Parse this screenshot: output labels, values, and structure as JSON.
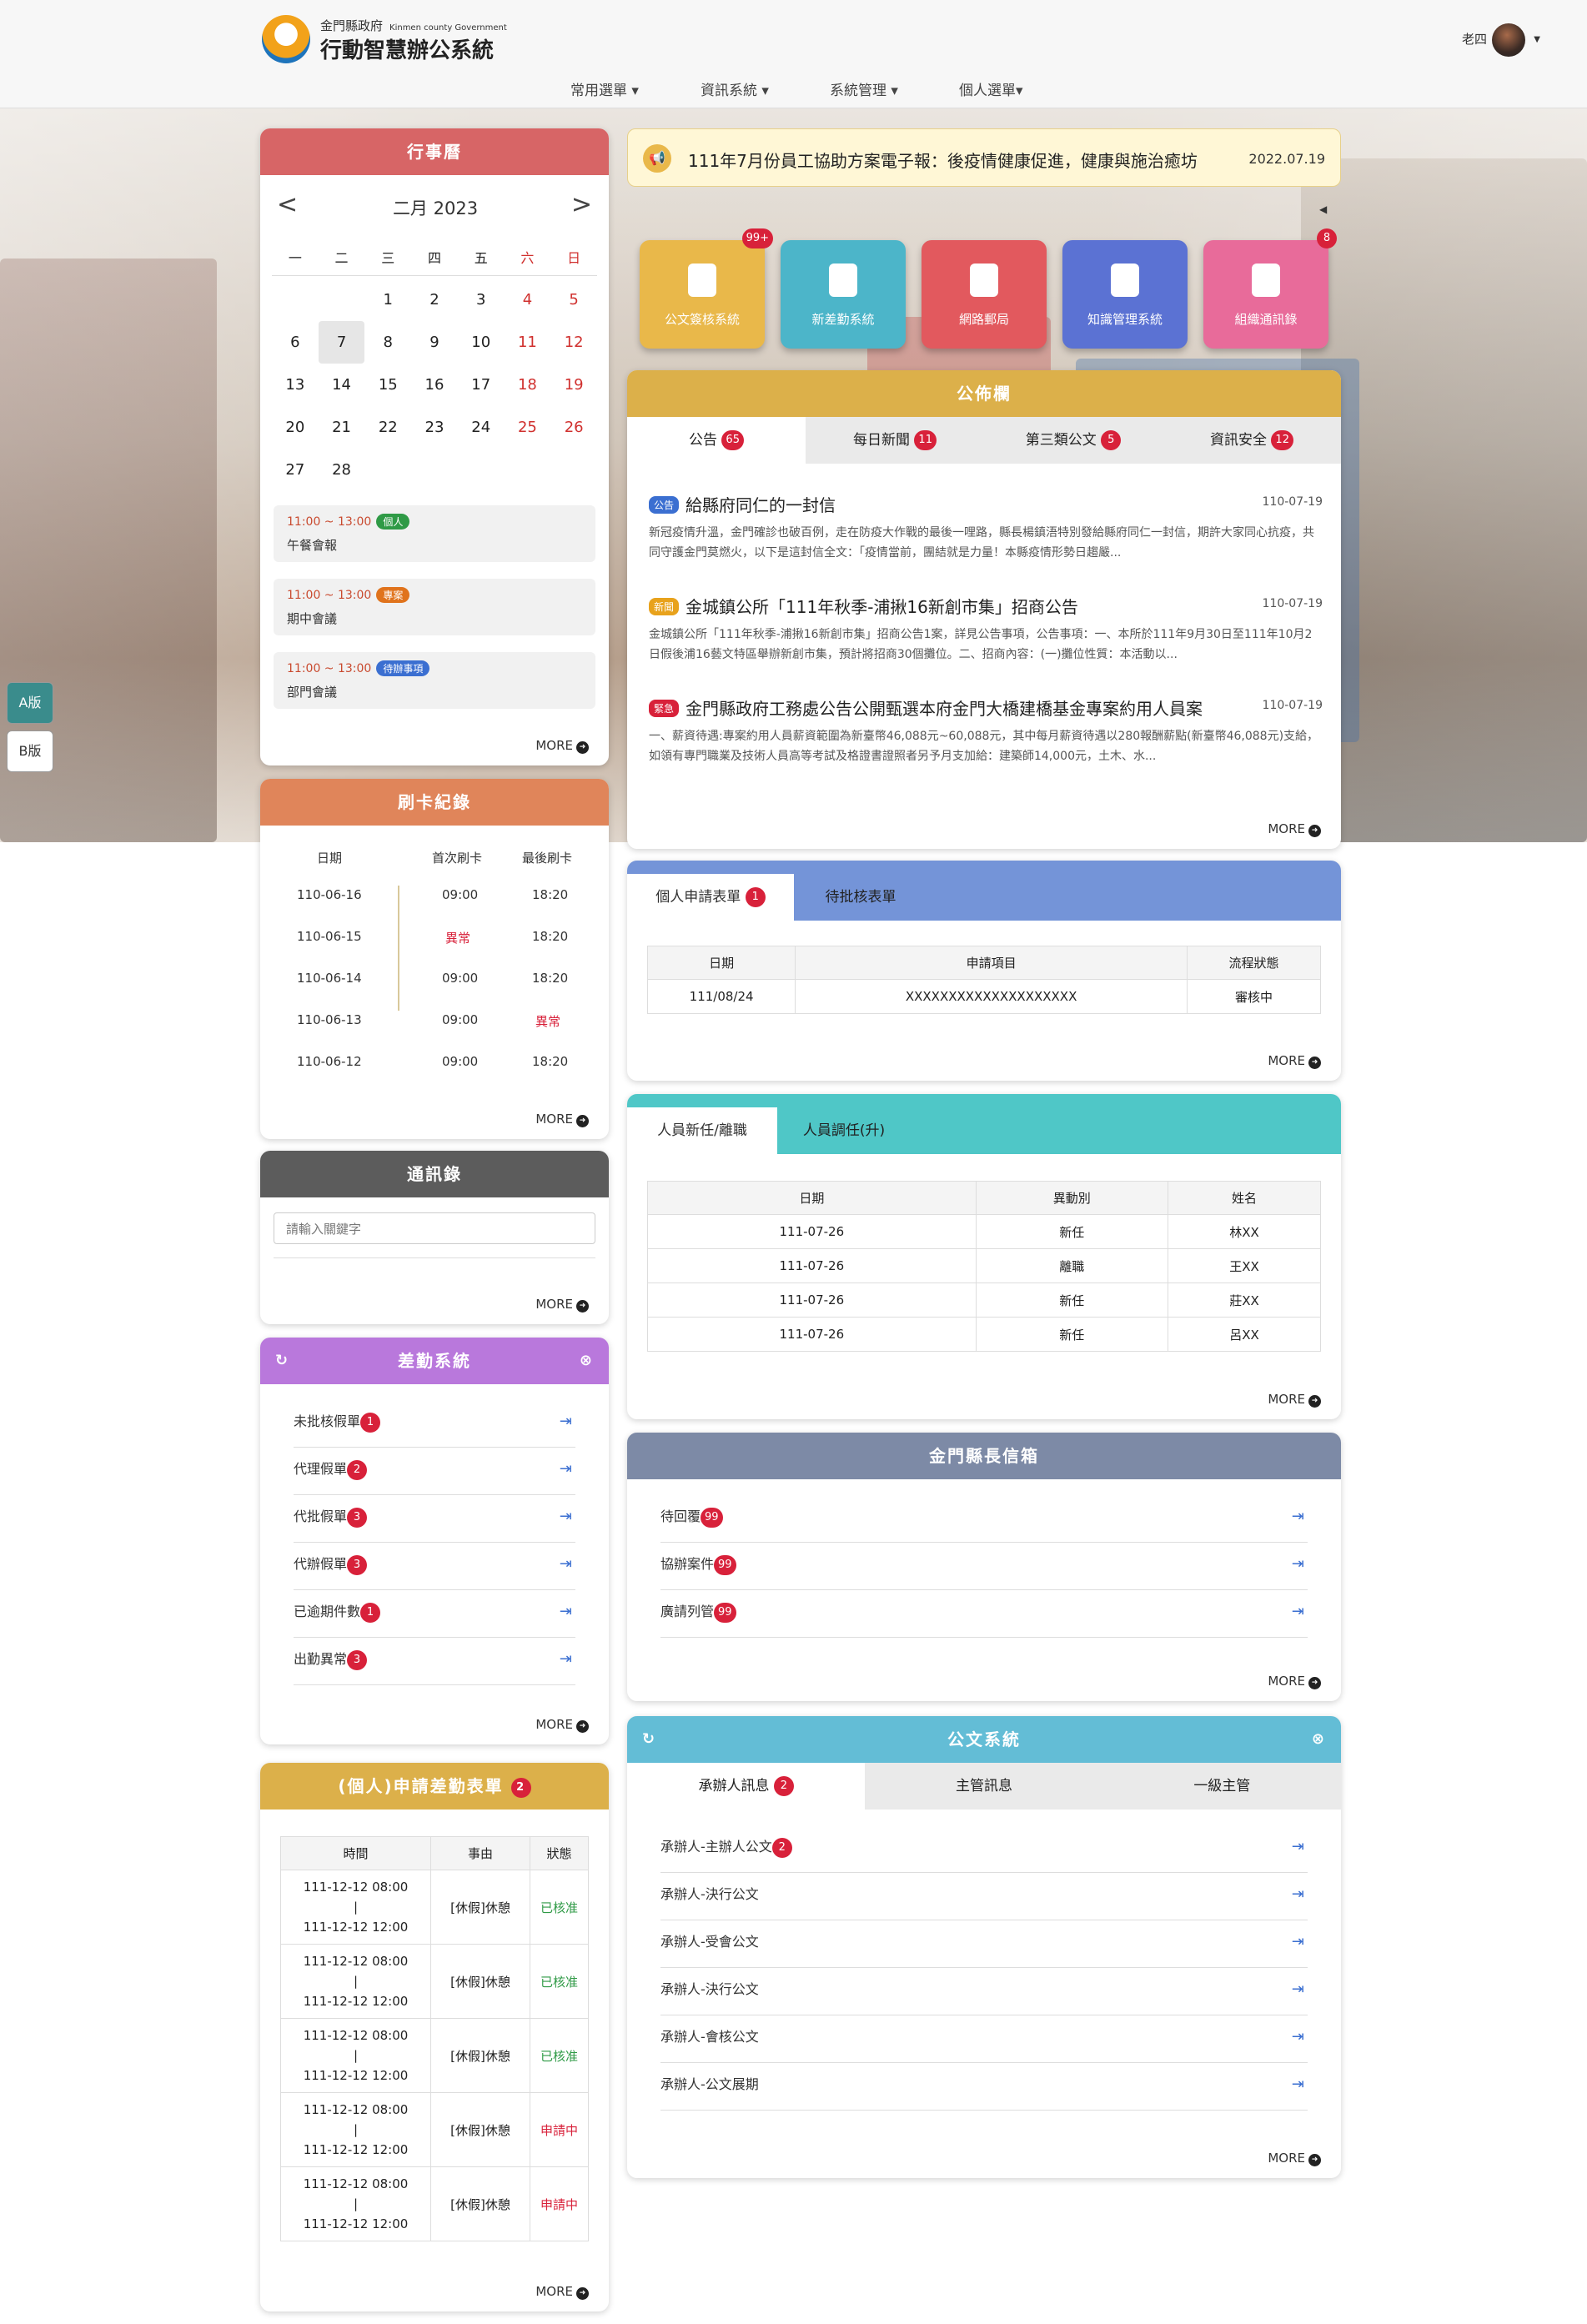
{
  "header": {
    "org": "金門縣政府",
    "org_en": "Kinmen county Government",
    "system": "行動智慧辦公系統",
    "user": "老四",
    "menu": [
      "常用選單 ▾",
      "資訊系統 ▾",
      "系統管理 ▾",
      "個人選單▾"
    ]
  },
  "side": {
    "a": "A版",
    "b": "B版"
  },
  "calendar": {
    "title": "行事曆",
    "month": "二月 2023",
    "prev": "<",
    "next": ">",
    "weekdays": [
      "一",
      "二",
      "三",
      "四",
      "五",
      "六",
      "日"
    ],
    "rows": [
      [
        "",
        "",
        "1",
        "2",
        "3",
        "4",
        "5"
      ],
      [
        "6",
        "7",
        "8",
        "9",
        "10",
        "11",
        "12"
      ],
      [
        "13",
        "14",
        "15",
        "16",
        "17",
        "18",
        "19"
      ],
      [
        "20",
        "21",
        "22",
        "23",
        "24",
        "25",
        "26"
      ],
      [
        "27",
        "28",
        "",
        "",
        "",
        "",
        ""
      ]
    ],
    "events": [
      {
        "time": "11:00 ~ 13:00",
        "tag": "個人",
        "name": "午餐會報"
      },
      {
        "time": "11:00 ~ 13:00",
        "tag": "專案",
        "name": "期中會議"
      },
      {
        "time": "11:00 ~ 13:00",
        "tag": "待辦事項",
        "name": "部門會議"
      }
    ],
    "more": "MORE"
  },
  "card_log": {
    "title": "刷卡紀錄",
    "headers": [
      "日期",
      "首次刷卡",
      "最後刷卡"
    ],
    "rows": [
      [
        "110-06-16",
        "09:00",
        "18:20"
      ],
      [
        "110-06-15",
        "異常",
        "18:20"
      ],
      [
        "110-06-14",
        "09:00",
        "18:20"
      ],
      [
        "110-06-13",
        "09:00",
        "異常"
      ],
      [
        "110-06-12",
        "09:00",
        "18:20"
      ]
    ],
    "more": "MORE"
  },
  "contacts": {
    "title": "通訊錄",
    "placeholder": "請輸入關鍵字",
    "more": "MORE"
  },
  "attendance": {
    "title": "差勤系統",
    "items": [
      {
        "label": "未批核假單",
        "n": "1"
      },
      {
        "label": "代理假單",
        "n": "2"
      },
      {
        "label": "代批假單",
        "n": "3"
      },
      {
        "label": "代辦假單",
        "n": "3"
      },
      {
        "label": "已逾期件數",
        "n": "1"
      },
      {
        "label": "出勤異常",
        "n": "3"
      }
    ],
    "more": "MORE"
  },
  "leave": {
    "title": "(個人)申請差勤表單",
    "n": "2",
    "headers": [
      "時間",
      "事由",
      "狀態"
    ],
    "rows": [
      {
        "s": "111-12-12 08:00",
        "sep": "|",
        "e": "111-12-12 12:00",
        "r": "[休假]休憩",
        "st": "已核准"
      },
      {
        "s": "111-12-12 08:00",
        "sep": "|",
        "e": "111-12-12 12:00",
        "r": "[休假]休憩",
        "st": "已核准"
      },
      {
        "s": "111-12-12 08:00",
        "sep": "|",
        "e": "111-12-12 12:00",
        "r": "[休假]休憩",
        "st": "已核准"
      },
      {
        "s": "111-12-12 08:00",
        "sep": "|",
        "e": "111-12-12 12:00",
        "r": "[休假]休憩",
        "st": "申請中"
      },
      {
        "s": "111-12-12 08:00",
        "sep": "|",
        "e": "111-12-12 12:00",
        "r": "[休假]休憩",
        "st": "申請中"
      }
    ],
    "more": "MORE"
  },
  "news": {
    "text": "111年7月份員工協助方案電子報：後疫情健康促進，健康與施治癒坊",
    "date": "2022.07.19"
  },
  "apps": [
    {
      "label": "公文簽核系統",
      "badge": "99+",
      "color": "#e9b84a"
    },
    {
      "label": "新差勤系統",
      "badge": "",
      "color": "#4cb5c9"
    },
    {
      "label": "網路郵局",
      "badge": "",
      "color": "#e2595e"
    },
    {
      "label": "知識管理系統",
      "badge": "",
      "color": "#5b72d3"
    },
    {
      "label": "組織通訊錄",
      "badge": "8",
      "color": "#e86b9a"
    }
  ],
  "bulletin": {
    "title": "公佈欄",
    "tabs": [
      {
        "label": "公告",
        "n": "65"
      },
      {
        "label": "每日新聞",
        "n": "11"
      },
      {
        "label": "第三類公文",
        "n": "5"
      },
      {
        "label": "資訊安全",
        "n": "12"
      }
    ],
    "items": [
      {
        "lb": "公告",
        "lbc": "#3b6fd1",
        "h": "給縣府同仁的一封信",
        "d": "110-07-19",
        "p": "新冠疫情升溫，金門確診也破百例，走在防疫大作戰的最後一哩路，縣長楊鎮浯特別發給縣府同仁一封信，期許大家同心抗疫，共同守護金門莫燃火，以下是這封信全文：「疫情當前，團結就是力量！本縣疫情形勢日趨嚴..."
      },
      {
        "lb": "新聞",
        "lbc": "#e8a21c",
        "h": "金城鎮公所「111年秋季-浦揪16新創市集」招商公告",
        "d": "110-07-19",
        "p": "金城鎮公所「111年秋季-浦揪16新創市集」招商公告1案，詳見公告事項，公告事項：一、本所於111年9月30日至111年10月2日假後浦16藝文特區舉辦新創市集，預計將招商30個攤位。二、招商內容：(一)攤位性質：本活動以..."
      },
      {
        "lb": "緊急",
        "lbc": "#d8213a",
        "h": "金門縣政府工務處公告公開甄選本府金門大橋建橋基金專案約用人員案",
        "d": "110-07-19",
        "p": "一、薪資待遇:專案約用人員薪資範圍為新臺幣46,088元~60,088元，其中每月薪資待遇以280報酬薪點(新臺幣46,088元)支給，如領有專門職業及技術人員高等考試及格證書證照者另予月支加給：建築師14,000元，土木、水..."
      }
    ],
    "more": "MORE"
  },
  "forms": {
    "tabs": [
      {
        "label": "個人申請表單",
        "n": "1"
      },
      {
        "label": "待批核表單",
        "n": ""
      }
    ],
    "headers": [
      "日期",
      "申請項目",
      "流程狀態"
    ],
    "rows": [
      [
        "111/08/24",
        "XXXXXXXXXXXXXXXXXXXX",
        "審核中"
      ]
    ],
    "more": "MORE"
  },
  "personnel": {
    "tabs": [
      "人員新任/離職",
      "人員調任(升)"
    ],
    "headers": [
      "日期",
      "異動別",
      "姓名"
    ],
    "rows": [
      [
        "111-07-26",
        "新任",
        "林XX"
      ],
      [
        "111-07-26",
        "離職",
        "王XX"
      ],
      [
        "111-07-26",
        "新任",
        "莊XX"
      ],
      [
        "111-07-26",
        "新任",
        "呂XX"
      ]
    ],
    "more": "MORE"
  },
  "mayor": {
    "title": "金門縣長信箱",
    "items": [
      {
        "label": "待回覆",
        "n": "99"
      },
      {
        "label": "協辦案件",
        "n": "99"
      },
      {
        "label": "廣請列管",
        "n": "99"
      }
    ],
    "more": "MORE"
  },
  "docs": {
    "title": "公文系統",
    "tabs": [
      {
        "label": "承辦人訊息",
        "n": "2"
      },
      {
        "label": "主管訊息",
        "n": ""
      },
      {
        "label": "一級主管",
        "n": ""
      }
    ],
    "items": [
      {
        "label": "承辦人-主辦人公文",
        "n": "2"
      },
      {
        "label": "承辦人-決行公文",
        "n": ""
      },
      {
        "label": "承辦人-受會公文",
        "n": ""
      },
      {
        "label": "承辦人-決行公文",
        "n": ""
      },
      {
        "label": "承辦人-會核公文",
        "n": ""
      },
      {
        "label": "承辦人-公文展期",
        "n": ""
      }
    ],
    "more": "MORE"
  }
}
